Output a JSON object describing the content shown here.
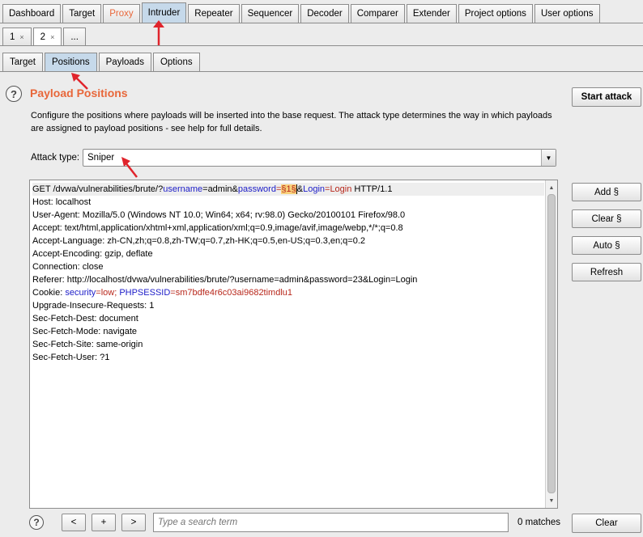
{
  "main_tabs": [
    "Dashboard",
    "Target",
    "Proxy",
    "Intruder",
    "Repeater",
    "Sequencer",
    "Decoder",
    "Comparer",
    "Extender",
    "Project options",
    "User options"
  ],
  "sub_tabs": [
    {
      "label": "1",
      "close": "×"
    },
    {
      "label": "2",
      "close": "×"
    },
    {
      "label": "..."
    }
  ],
  "section_tabs": [
    "Target",
    "Positions",
    "Payloads",
    "Options"
  ],
  "panel": {
    "title": "Payload Positions",
    "description": "Configure the positions where payloads will be inserted into the base request. The attack type determines the way in which payloads are assigned to payload positions - see help for full details.",
    "start_attack": "Start attack",
    "attack_type_label": "Attack type:",
    "attack_type_value": "Sniper"
  },
  "side_buttons": [
    "Add §",
    "Clear §",
    "Auto §",
    "Refresh"
  ],
  "request": {
    "line1": {
      "prefix": "GET /dvwa/vulnerabilities/brute/?",
      "k1": "username",
      "eq1": "=admin&",
      "k2": "password",
      "eq2": "=",
      "marker": "§1§",
      "amp": "&",
      "k3": "Login",
      "v3": "=Login",
      "suffix": " HTTP/1.1"
    },
    "host": "Host: localhost",
    "user_agent": "User-Agent: Mozilla/5.0 (Windows NT 10.0; Win64; x64; rv:98.0) Gecko/20100101 Firefox/98.0",
    "accept": "Accept: text/html,application/xhtml+xml,application/xml;q=0.9,image/avif,image/webp,*/*;q=0.8",
    "accept_language": "Accept-Language: zh-CN,zh;q=0.8,zh-TW;q=0.7,zh-HK;q=0.5,en-US;q=0.3,en;q=0.2",
    "accept_encoding": "Accept-Encoding: gzip, deflate",
    "connection": "Connection: close",
    "referer": "Referer: http://localhost/dvwa/vulnerabilities/brute/?username=admin&password=23&Login=Login",
    "cookie": {
      "prefix": "Cookie: ",
      "k1": "security",
      "v1": "=low; ",
      "k2": "PHPSESSID",
      "v2": "=sm7bdfe4r6c03ai9682timdlu1"
    },
    "upgrade": "Upgrade-Insecure-Requests: 1",
    "fetch_dest": "Sec-Fetch-Dest: document",
    "fetch_mode": "Sec-Fetch-Mode: navigate",
    "fetch_site": "Sec-Fetch-Site: same-origin",
    "fetch_user": "Sec-Fetch-User: ?1"
  },
  "bottom": {
    "prev": "<",
    "add": "+",
    "next": ">",
    "search_placeholder": "Type a search term",
    "matches": "0 matches",
    "clear": "Clear"
  },
  "colors": {
    "accent": "#e8673a",
    "annotation": "#e0242c",
    "active_tab": "#c6d9ea"
  }
}
